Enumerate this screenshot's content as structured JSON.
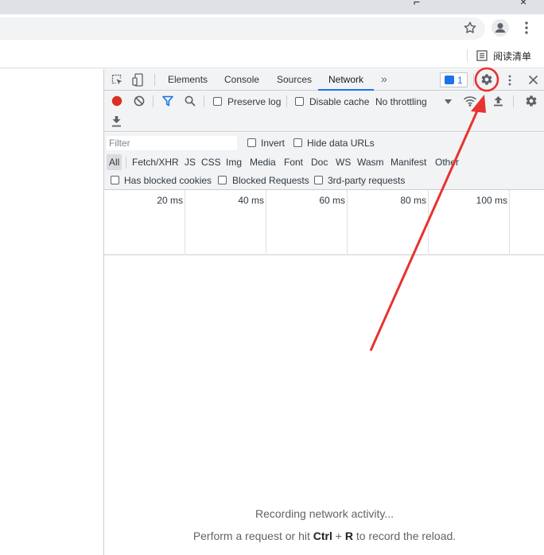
{
  "browser": {
    "reading_list_label": "阅读清单",
    "icons": {
      "star": "star-icon",
      "profile": "profile-icon",
      "menu": "more-vert-icon",
      "reading_list": "reading-list-icon"
    }
  },
  "devtools": {
    "tabs": [
      "Elements",
      "Console",
      "Sources",
      "Network"
    ],
    "active_tab": "Network",
    "issues_count": "1",
    "network": {
      "preserve_log": "Preserve log",
      "disable_cache": "Disable cache",
      "throttling": "No throttling",
      "filter_placeholder": "Filter",
      "invert": "Invert",
      "hide_data_urls": "Hide data URLs",
      "types": [
        "All",
        "Fetch/XHR",
        "JS",
        "CSS",
        "Img",
        "Media",
        "Font",
        "Doc",
        "WS",
        "Wasm",
        "Manifest",
        "Other"
      ],
      "has_blocked_cookies": "Has blocked cookies",
      "blocked_requests": "Blocked Requests",
      "third_party": "3rd-party requests",
      "timeline_ticks": [
        "20 ms",
        "40 ms",
        "60 ms",
        "80 ms",
        "100 ms"
      ],
      "recording_text": "Recording network activity...",
      "perform_prefix": "Perform a request or hit ",
      "key_ctrl": "Ctrl",
      "plus": " + ",
      "key_r": "R",
      "perform_suffix": " to record the reload."
    }
  },
  "colors": {
    "accent": "#1a73e8",
    "record": "#d93025",
    "annotation": "#e8332f"
  }
}
